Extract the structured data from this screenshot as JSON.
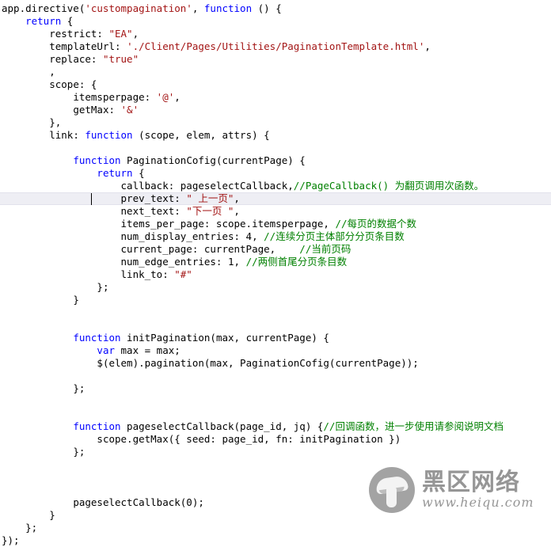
{
  "editor": {
    "language": "JavaScript",
    "colors": {
      "background": "#ffffff",
      "text": "#000000",
      "keyword": "#0000ff",
      "string": "#a31515",
      "comment": "#008000",
      "current_line_bg": "#eeeef4",
      "current_line_border": "#e2e2ec"
    },
    "current_line_index": 15,
    "caret_column": 12
  },
  "code_lines": [
    {
      "indent": 0,
      "tokens": [
        {
          "t": "app.directive(",
          "c": "plain"
        },
        {
          "t": "'custompagination'",
          "c": "str"
        },
        {
          "t": ", ",
          "c": "plain"
        },
        {
          "t": "function",
          "c": "kw"
        },
        {
          "t": " () {",
          "c": "plain"
        }
      ]
    },
    {
      "indent": 1,
      "tokens": [
        {
          "t": "return",
          "c": "kw"
        },
        {
          "t": " {",
          "c": "plain"
        }
      ]
    },
    {
      "indent": 2,
      "tokens": [
        {
          "t": "restrict: ",
          "c": "plain"
        },
        {
          "t": "\"EA\"",
          "c": "str"
        },
        {
          "t": ",",
          "c": "plain"
        }
      ]
    },
    {
      "indent": 2,
      "tokens": [
        {
          "t": "templateUrl: ",
          "c": "plain"
        },
        {
          "t": "'./Client/Pages/Utilities/PaginationTemplate.html'",
          "c": "str"
        },
        {
          "t": ",",
          "c": "plain"
        }
      ]
    },
    {
      "indent": 2,
      "tokens": [
        {
          "t": "replace: ",
          "c": "plain"
        },
        {
          "t": "\"true\"",
          "c": "str"
        }
      ]
    },
    {
      "indent": 2,
      "tokens": [
        {
          "t": ",",
          "c": "plain"
        }
      ]
    },
    {
      "indent": 2,
      "tokens": [
        {
          "t": "scope: {",
          "c": "plain"
        }
      ]
    },
    {
      "indent": 3,
      "tokens": [
        {
          "t": "itemsperpage: ",
          "c": "plain"
        },
        {
          "t": "'@'",
          "c": "str"
        },
        {
          "t": ",",
          "c": "plain"
        }
      ]
    },
    {
      "indent": 3,
      "tokens": [
        {
          "t": "getMax: ",
          "c": "plain"
        },
        {
          "t": "'&'",
          "c": "str"
        }
      ]
    },
    {
      "indent": 2,
      "tokens": [
        {
          "t": "},",
          "c": "plain"
        }
      ]
    },
    {
      "indent": 2,
      "tokens": [
        {
          "t": "link: ",
          "c": "plain"
        },
        {
          "t": "function",
          "c": "kw"
        },
        {
          "t": " (scope, elem, attrs) {",
          "c": "plain"
        }
      ]
    },
    {
      "indent": 0,
      "tokens": []
    },
    {
      "indent": 3,
      "tokens": [
        {
          "t": "function",
          "c": "kw"
        },
        {
          "t": " PaginationCofig(currentPage) {",
          "c": "plain"
        }
      ]
    },
    {
      "indent": 4,
      "tokens": [
        {
          "t": "return",
          "c": "kw"
        },
        {
          "t": " {",
          "c": "plain"
        }
      ]
    },
    {
      "indent": 5,
      "tokens": [
        {
          "t": "callback: pageselectCallback,",
          "c": "plain"
        },
        {
          "t": "//PageCallback() ",
          "c": "cmt"
        },
        {
          "t": "为翻页调用次函数。",
          "c": "cmt cjk"
        }
      ]
    },
    {
      "indent": 5,
      "tokens": [
        {
          "t": "prev_text: ",
          "c": "plain"
        },
        {
          "t": "\" ",
          "c": "str"
        },
        {
          "t": "上一页",
          "c": "str cjk"
        },
        {
          "t": "\"",
          "c": "str"
        },
        {
          "t": ",",
          "c": "plain"
        }
      ]
    },
    {
      "indent": 5,
      "tokens": [
        {
          "t": "next_text: ",
          "c": "plain"
        },
        {
          "t": "\"",
          "c": "str"
        },
        {
          "t": "下一页",
          "c": "str cjk"
        },
        {
          "t": " \"",
          "c": "str"
        },
        {
          "t": ",",
          "c": "plain"
        }
      ]
    },
    {
      "indent": 5,
      "tokens": [
        {
          "t": "items_per_page: scope.itemsperpage, ",
          "c": "plain"
        },
        {
          "t": "//",
          "c": "cmt"
        },
        {
          "t": "每页的数据个数",
          "c": "cmt cjk"
        }
      ]
    },
    {
      "indent": 5,
      "tokens": [
        {
          "t": "num_display_entries: 4, ",
          "c": "plain"
        },
        {
          "t": "//",
          "c": "cmt"
        },
        {
          "t": "连续分页主体部分分页条目数",
          "c": "cmt cjk"
        }
      ]
    },
    {
      "indent": 5,
      "tokens": [
        {
          "t": "current_page: currentPage,    ",
          "c": "plain"
        },
        {
          "t": "//",
          "c": "cmt"
        },
        {
          "t": "当前页码",
          "c": "cmt cjk"
        }
      ]
    },
    {
      "indent": 5,
      "tokens": [
        {
          "t": "num_edge_entries: 1, ",
          "c": "plain"
        },
        {
          "t": "//",
          "c": "cmt"
        },
        {
          "t": "两侧首尾分页条目数",
          "c": "cmt cjk"
        }
      ]
    },
    {
      "indent": 5,
      "tokens": [
        {
          "t": "link_to: ",
          "c": "plain"
        },
        {
          "t": "\"#\"",
          "c": "str"
        }
      ]
    },
    {
      "indent": 4,
      "tokens": [
        {
          "t": "};",
          "c": "plain"
        }
      ]
    },
    {
      "indent": 3,
      "tokens": [
        {
          "t": "}",
          "c": "plain"
        }
      ]
    },
    {
      "indent": 0,
      "tokens": []
    },
    {
      "indent": 0,
      "tokens": []
    },
    {
      "indent": 3,
      "tokens": [
        {
          "t": "function",
          "c": "kw"
        },
        {
          "t": " initPagination(max, currentPage) {",
          "c": "plain"
        }
      ]
    },
    {
      "indent": 4,
      "tokens": [
        {
          "t": "var",
          "c": "kw"
        },
        {
          "t": " max = max;",
          "c": "plain"
        }
      ]
    },
    {
      "indent": 4,
      "tokens": [
        {
          "t": "$(elem).pagination(max, PaginationCofig(currentPage));",
          "c": "plain"
        }
      ]
    },
    {
      "indent": 0,
      "tokens": []
    },
    {
      "indent": 3,
      "tokens": [
        {
          "t": "};",
          "c": "plain"
        }
      ]
    },
    {
      "indent": 0,
      "tokens": []
    },
    {
      "indent": 0,
      "tokens": []
    },
    {
      "indent": 3,
      "tokens": [
        {
          "t": "function",
          "c": "kw"
        },
        {
          "t": " pageselectCallback(page_id, jq) {",
          "c": "plain"
        },
        {
          "t": "//",
          "c": "cmt"
        },
        {
          "t": "回调函数，进一步使用请参阅说明文档",
          "c": "cmt cjk"
        }
      ]
    },
    {
      "indent": 4,
      "tokens": [
        {
          "t": "scope.getMax({ seed: page_id, fn: initPagination })",
          "c": "plain"
        }
      ]
    },
    {
      "indent": 3,
      "tokens": [
        {
          "t": "};",
          "c": "plain"
        }
      ]
    },
    {
      "indent": 0,
      "tokens": []
    },
    {
      "indent": 0,
      "tokens": []
    },
    {
      "indent": 0,
      "tokens": []
    },
    {
      "indent": 3,
      "tokens": [
        {
          "t": "pageselectCallback(0);",
          "c": "plain"
        }
      ]
    },
    {
      "indent": 2,
      "tokens": [
        {
          "t": "}",
          "c": "plain"
        }
      ]
    },
    {
      "indent": 1,
      "tokens": [
        {
          "t": "};",
          "c": "plain"
        }
      ]
    },
    {
      "indent": 0,
      "tokens": [
        {
          "t": "});",
          "c": "plain"
        }
      ]
    }
  ],
  "watermark": {
    "brand_cn": "黑区网络",
    "url": "www.heiqu.com",
    "logo_icon": "mushroom-logo-icon",
    "color": "#8e8e8e"
  }
}
